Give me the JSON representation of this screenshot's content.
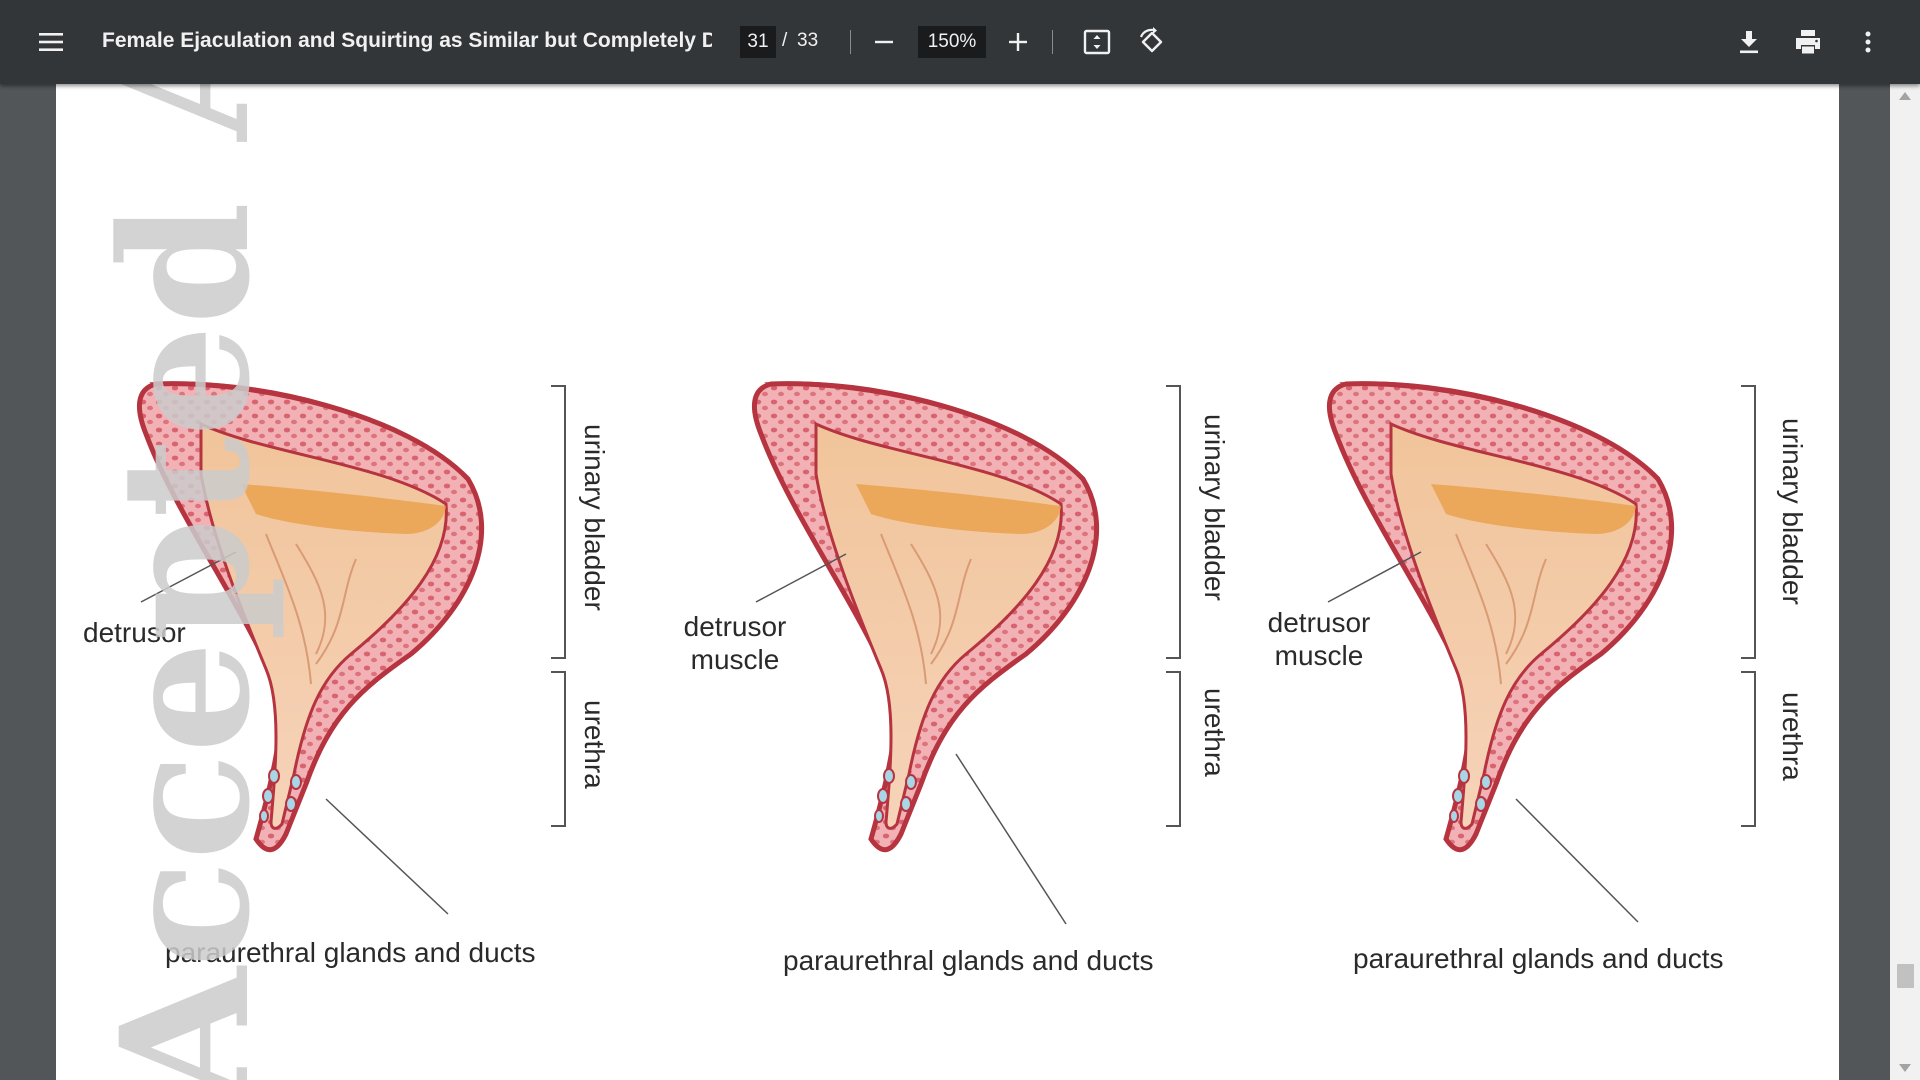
{
  "toolbar": {
    "menu_icon": "hamburger-menu-icon",
    "title": "Female Ejaculation and Squirting as Similar but Completely Diff...",
    "current_page": "31",
    "page_separator": "/",
    "total_pages": "33",
    "zoom_level": "150%",
    "icons": {
      "zoom_out": "minus-icon",
      "zoom_in": "plus-icon",
      "fit": "fit-to-page-icon",
      "rotate": "rotate-icon",
      "download": "download-icon",
      "print": "print-icon",
      "more": "more-vert-icon"
    }
  },
  "document": {
    "watermark": "Accepted Article",
    "figures": [
      {
        "detrusor_label": "detrusor",
        "bladder_label": "urinary bladder",
        "urethra_label": "urethra",
        "glands_label": "paraurethral glands and ducts"
      },
      {
        "detrusor_label_line1": "detrusor",
        "detrusor_label_line2": "muscle",
        "bladder_label": "urinary bladder",
        "urethra_label": "urethra",
        "glands_label": "paraurethral glands and ducts"
      },
      {
        "detrusor_label_line1": "detrusor",
        "detrusor_label_line2": "muscle",
        "bladder_label": "urinary bladder",
        "urethra_label": "urethra",
        "glands_label": "paraurethral glands and ducts"
      }
    ]
  },
  "colors": {
    "toolbar_bg": "#323639",
    "viewer_bg": "#525659",
    "tissue_outline": "#b5343f",
    "tissue_fill": "#f1aeb1",
    "mucosa": "#f3cfa8",
    "fluid": "#e8a04a",
    "gland": "#a9d6e6"
  }
}
